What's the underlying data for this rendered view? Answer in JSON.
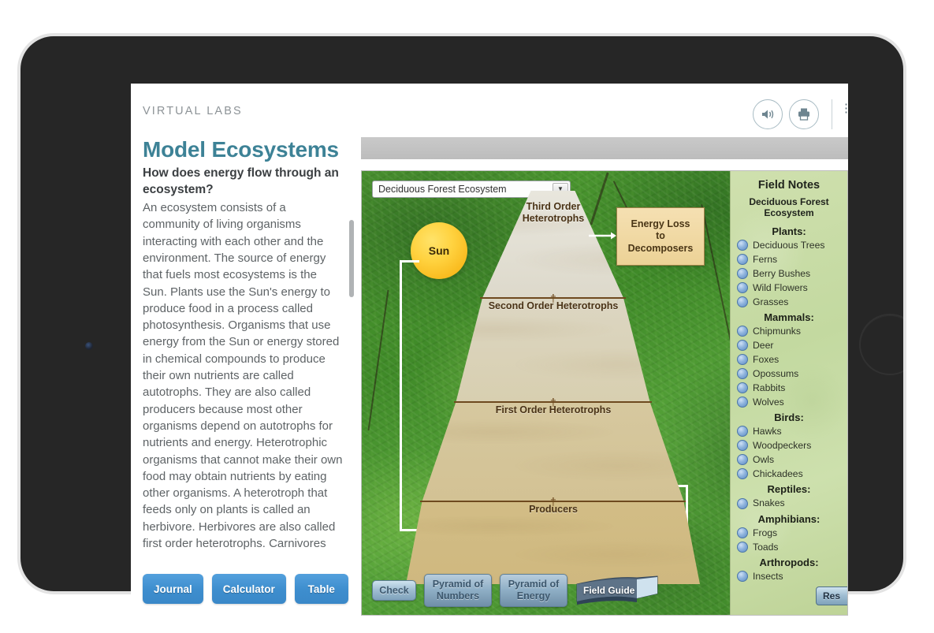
{
  "header": {
    "brand": "VIRTUAL LABS",
    "speaker_icon": "speaker-icon",
    "print_icon": "printer-icon",
    "extra_partial": "⋮"
  },
  "lesson": {
    "title": "Model Ecosystems",
    "question": "How does energy flow through an ecosystem?",
    "body": "An ecosystem consists of a community of living organisms interacting with each other and the environment. The source of energy that fuels most ecosystems is the Sun. Plants use the Sun's energy to produce food in a process called photosynthesis. Organisms that use energy from the Sun or energy stored in chemical compounds to produce their own nutrients are called autotrophs. They are also called producers because most other organisms depend on autotrophs for nutrients and energy. Heterotrophic organisms that cannot make their own food may obtain nutrients by eating other organisms. A heterotroph that feeds only on plants is called an herbivore. Herbivores are also called first order heterotrophs. Carnivores that feed on herbivores are called second order heterotrophs. Carnivores that feed on other carnivores"
  },
  "tools": {
    "journal": "Journal",
    "calculator": "Calculator",
    "table": "Table"
  },
  "simulation": {
    "ecosystem_select": {
      "value": "Deciduous Forest Ecosystem",
      "caret_icon": "chevron-down-icon"
    },
    "sun_label": "Sun",
    "energy_loss_label": "Energy Loss to Decomposers",
    "energy_loss_lines": [
      "Energy Loss",
      "to",
      "Decomposers"
    ],
    "pyramid_levels": [
      {
        "label": "Third Order Heterotrophs",
        "lines": [
          "Third Order",
          "Heterotrophs"
        ]
      },
      {
        "label": "Second Order Heterotrophs",
        "lines": [
          "Second Order Heterotrophs"
        ]
      },
      {
        "label": "First Order Heterotrophs",
        "lines": [
          "First Order Heterotrophs"
        ]
      },
      {
        "label": "Producers",
        "lines": [
          "Producers"
        ]
      }
    ],
    "buttons": {
      "check": "Check",
      "pyramid_of_numbers": "Pyramid of Numbers",
      "pyramid_of_numbers_lines": [
        "Pyramid of",
        "Numbers"
      ],
      "pyramid_of_energy": "Pyramid of Energy",
      "pyramid_of_energy_lines": [
        "Pyramid of",
        "Energy"
      ],
      "field_guide": "Field Guide",
      "reset": "Res"
    }
  },
  "field_notes": {
    "title": "Field Notes",
    "subtitle_lines": [
      "Deciduous Forest",
      "Ecosystem"
    ],
    "groups": [
      {
        "name": "Plants:",
        "items": [
          "Deciduous Trees",
          "Ferns",
          "Berry Bushes",
          "Wild Flowers",
          "Grasses"
        ]
      },
      {
        "name": "Mammals:",
        "items": [
          "Chipmunks",
          "Deer",
          "Foxes",
          "Opossums",
          "Rabbits",
          "Wolves"
        ]
      },
      {
        "name": "Birds:",
        "items": [
          "Hawks",
          "Woodpeckers",
          "Owls",
          "Chickadees"
        ]
      },
      {
        "name": "Reptiles:",
        "items": [
          "Snakes"
        ]
      },
      {
        "name": "Amphibians:",
        "items": [
          "Frogs",
          "Toads"
        ]
      },
      {
        "name": "Arthropods:",
        "items": [
          "Insects"
        ]
      }
    ]
  },
  "colors": {
    "title_blue": "#3d8296",
    "button_blue": "#3e8ece",
    "pyramid_divider": "#6e4a1f",
    "callout_tan": "#ecd296",
    "field_notes_green": "#c3d9a0",
    "sun_yellow": "#ffd23f"
  }
}
